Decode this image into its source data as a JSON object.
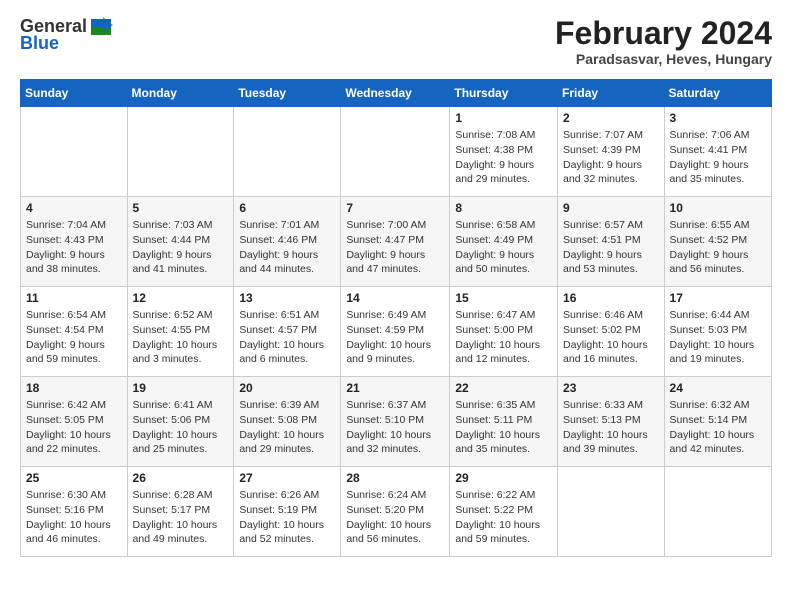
{
  "header": {
    "logo_general": "General",
    "logo_blue": "Blue",
    "main_title": "February 2024",
    "subtitle": "Paradsasvar, Heves, Hungary"
  },
  "columns": [
    "Sunday",
    "Monday",
    "Tuesday",
    "Wednesday",
    "Thursday",
    "Friday",
    "Saturday"
  ],
  "weeks": [
    [
      {
        "day": "",
        "detail": ""
      },
      {
        "day": "",
        "detail": ""
      },
      {
        "day": "",
        "detail": ""
      },
      {
        "day": "",
        "detail": ""
      },
      {
        "day": "1",
        "detail": "Sunrise: 7:08 AM\nSunset: 4:38 PM\nDaylight: 9 hours\nand 29 minutes."
      },
      {
        "day": "2",
        "detail": "Sunrise: 7:07 AM\nSunset: 4:39 PM\nDaylight: 9 hours\nand 32 minutes."
      },
      {
        "day": "3",
        "detail": "Sunrise: 7:06 AM\nSunset: 4:41 PM\nDaylight: 9 hours\nand 35 minutes."
      }
    ],
    [
      {
        "day": "4",
        "detail": "Sunrise: 7:04 AM\nSunset: 4:43 PM\nDaylight: 9 hours\nand 38 minutes."
      },
      {
        "day": "5",
        "detail": "Sunrise: 7:03 AM\nSunset: 4:44 PM\nDaylight: 9 hours\nand 41 minutes."
      },
      {
        "day": "6",
        "detail": "Sunrise: 7:01 AM\nSunset: 4:46 PM\nDaylight: 9 hours\nand 44 minutes."
      },
      {
        "day": "7",
        "detail": "Sunrise: 7:00 AM\nSunset: 4:47 PM\nDaylight: 9 hours\nand 47 minutes."
      },
      {
        "day": "8",
        "detail": "Sunrise: 6:58 AM\nSunset: 4:49 PM\nDaylight: 9 hours\nand 50 minutes."
      },
      {
        "day": "9",
        "detail": "Sunrise: 6:57 AM\nSunset: 4:51 PM\nDaylight: 9 hours\nand 53 minutes."
      },
      {
        "day": "10",
        "detail": "Sunrise: 6:55 AM\nSunset: 4:52 PM\nDaylight: 9 hours\nand 56 minutes."
      }
    ],
    [
      {
        "day": "11",
        "detail": "Sunrise: 6:54 AM\nSunset: 4:54 PM\nDaylight: 9 hours\nand 59 minutes."
      },
      {
        "day": "12",
        "detail": "Sunrise: 6:52 AM\nSunset: 4:55 PM\nDaylight: 10 hours\nand 3 minutes."
      },
      {
        "day": "13",
        "detail": "Sunrise: 6:51 AM\nSunset: 4:57 PM\nDaylight: 10 hours\nand 6 minutes."
      },
      {
        "day": "14",
        "detail": "Sunrise: 6:49 AM\nSunset: 4:59 PM\nDaylight: 10 hours\nand 9 minutes."
      },
      {
        "day": "15",
        "detail": "Sunrise: 6:47 AM\nSunset: 5:00 PM\nDaylight: 10 hours\nand 12 minutes."
      },
      {
        "day": "16",
        "detail": "Sunrise: 6:46 AM\nSunset: 5:02 PM\nDaylight: 10 hours\nand 16 minutes."
      },
      {
        "day": "17",
        "detail": "Sunrise: 6:44 AM\nSunset: 5:03 PM\nDaylight: 10 hours\nand 19 minutes."
      }
    ],
    [
      {
        "day": "18",
        "detail": "Sunrise: 6:42 AM\nSunset: 5:05 PM\nDaylight: 10 hours\nand 22 minutes."
      },
      {
        "day": "19",
        "detail": "Sunrise: 6:41 AM\nSunset: 5:06 PM\nDaylight: 10 hours\nand 25 minutes."
      },
      {
        "day": "20",
        "detail": "Sunrise: 6:39 AM\nSunset: 5:08 PM\nDaylight: 10 hours\nand 29 minutes."
      },
      {
        "day": "21",
        "detail": "Sunrise: 6:37 AM\nSunset: 5:10 PM\nDaylight: 10 hours\nand 32 minutes."
      },
      {
        "day": "22",
        "detail": "Sunrise: 6:35 AM\nSunset: 5:11 PM\nDaylight: 10 hours\nand 35 minutes."
      },
      {
        "day": "23",
        "detail": "Sunrise: 6:33 AM\nSunset: 5:13 PM\nDaylight: 10 hours\nand 39 minutes."
      },
      {
        "day": "24",
        "detail": "Sunrise: 6:32 AM\nSunset: 5:14 PM\nDaylight: 10 hours\nand 42 minutes."
      }
    ],
    [
      {
        "day": "25",
        "detail": "Sunrise: 6:30 AM\nSunset: 5:16 PM\nDaylight: 10 hours\nand 46 minutes."
      },
      {
        "day": "26",
        "detail": "Sunrise: 6:28 AM\nSunset: 5:17 PM\nDaylight: 10 hours\nand 49 minutes."
      },
      {
        "day": "27",
        "detail": "Sunrise: 6:26 AM\nSunset: 5:19 PM\nDaylight: 10 hours\nand 52 minutes."
      },
      {
        "day": "28",
        "detail": "Sunrise: 6:24 AM\nSunset: 5:20 PM\nDaylight: 10 hours\nand 56 minutes."
      },
      {
        "day": "29",
        "detail": "Sunrise: 6:22 AM\nSunset: 5:22 PM\nDaylight: 10 hours\nand 59 minutes."
      },
      {
        "day": "",
        "detail": ""
      },
      {
        "day": "",
        "detail": ""
      }
    ]
  ]
}
